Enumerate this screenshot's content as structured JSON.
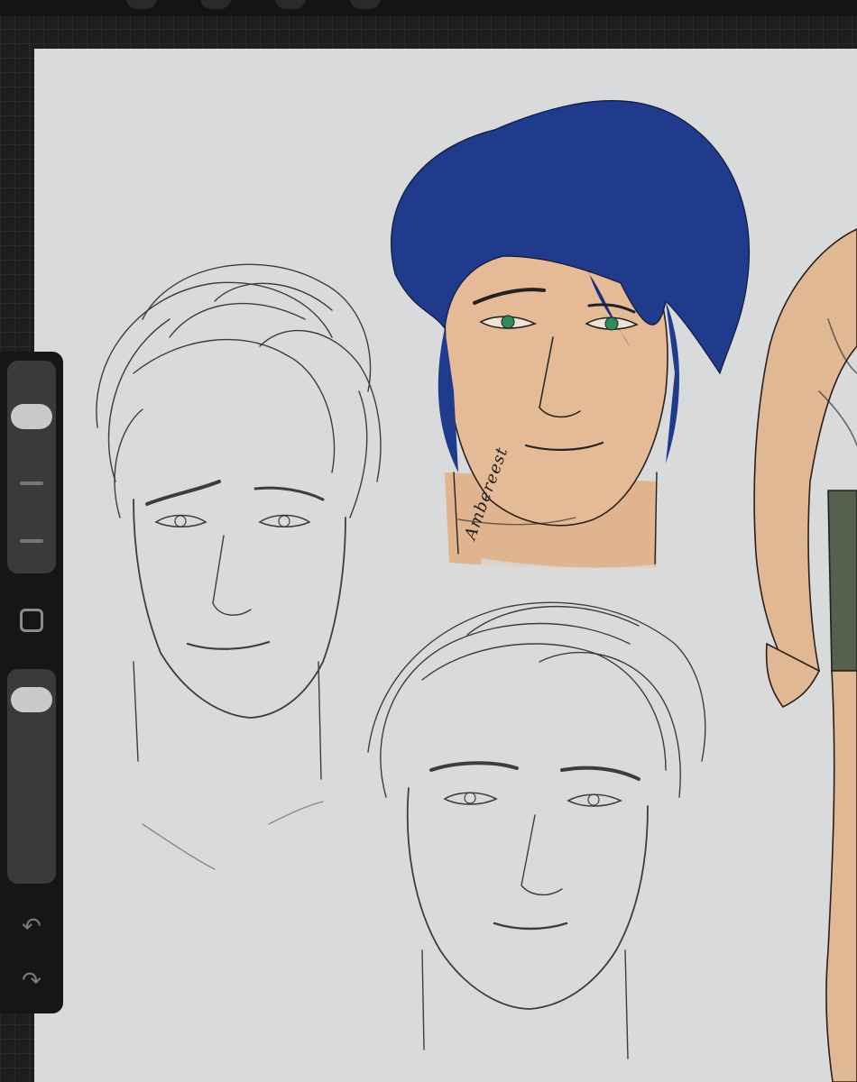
{
  "app": {
    "signature": "Ambereest"
  },
  "sidebar": {
    "size_slider_icon": "brush-size-slider",
    "modify_icon": "square-outline-icon",
    "opacity_slider_icon": "opacity-slider",
    "undo_icon": "undo-arrow-icon",
    "redo_icon": "redo-arrow-icon",
    "size_level": 0.78,
    "opacity_level": 0.92
  },
  "colors": {
    "canvas": "#d9dadb",
    "hair_blue": "#1f3a8a",
    "skin": "#e2b995",
    "shorts": "#56604e",
    "toolbar": "#161618"
  }
}
